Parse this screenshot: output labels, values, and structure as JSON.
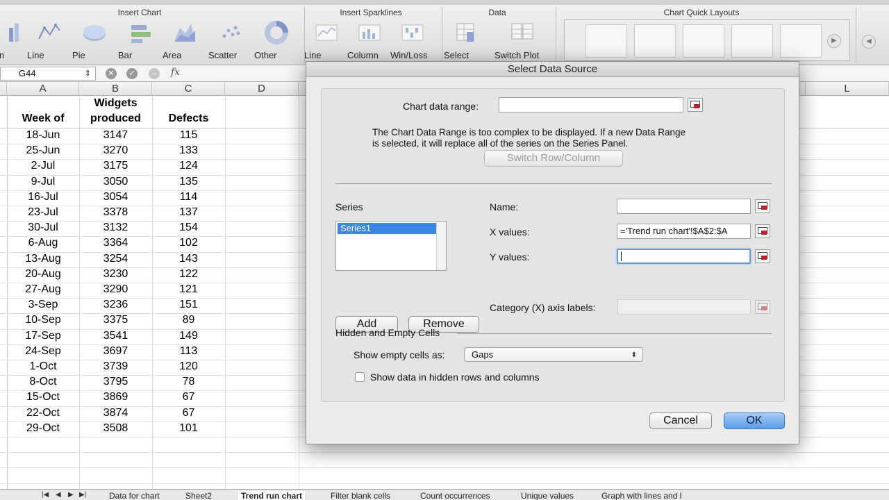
{
  "ribbon": {
    "groups": {
      "insert_chart": "Insert Chart",
      "insert_sparklines": "Insert Sparklines",
      "data": "Data",
      "chart_quick_layouts": "Chart Quick Layouts"
    },
    "chart_buttons": [
      "lumn",
      "Line",
      "Pie",
      "Bar",
      "Area",
      "Scatter",
      "Other"
    ],
    "sparkline_buttons": [
      "Line",
      "Column",
      "Win/Loss"
    ],
    "data_buttons": [
      "Select",
      "Switch Plot"
    ]
  },
  "formula_bar": {
    "name_box": "G44",
    "fx": "fx"
  },
  "sheet": {
    "columns": [
      "A",
      "B",
      "C",
      "D",
      "L"
    ],
    "headers": {
      "a": "Week of",
      "b1": "Widgets",
      "b2": "produced",
      "c": "Defects"
    },
    "rows": [
      [
        "18-Jun",
        "3147",
        "115"
      ],
      [
        "25-Jun",
        "3270",
        "133"
      ],
      [
        "2-Jul",
        "3175",
        "124"
      ],
      [
        "9-Jul",
        "3050",
        "135"
      ],
      [
        "16-Jul",
        "3054",
        "114"
      ],
      [
        "23-Jul",
        "3378",
        "137"
      ],
      [
        "30-Jul",
        "3132",
        "154"
      ],
      [
        "6-Aug",
        "3364",
        "102"
      ],
      [
        "13-Aug",
        "3254",
        "143"
      ],
      [
        "20-Aug",
        "3230",
        "122"
      ],
      [
        "27-Aug",
        "3290",
        "121"
      ],
      [
        "3-Sep",
        "3236",
        "151"
      ],
      [
        "10-Sep",
        "3375",
        "89"
      ],
      [
        "17-Sep",
        "3541",
        "149"
      ],
      [
        "24-Sep",
        "3697",
        "113"
      ],
      [
        "1-Oct",
        "3739",
        "120"
      ],
      [
        "8-Oct",
        "3795",
        "78"
      ],
      [
        "15-Oct",
        "3869",
        "67"
      ],
      [
        "22-Oct",
        "3874",
        "67"
      ],
      [
        "29-Oct",
        "3508",
        "101"
      ]
    ]
  },
  "sheet_tabs": [
    "Data for chart",
    "Sheet2",
    "Trend run chart",
    "Filter blank cells",
    "Count occurrences",
    "Unique values",
    "Graph with lines and l"
  ],
  "dialog": {
    "title": "Select Data Source",
    "chart_data_range_label": "Chart data range:",
    "chart_data_range_value": "",
    "info_line1": "The Chart Data Range is too complex to be displayed. If a new Data Range",
    "info_line2": "is selected, it will replace all of the series on the Series Panel.",
    "switch_button": "Switch Row/Column",
    "series_label": "Series",
    "series_items": [
      "Series1"
    ],
    "name_label": "Name:",
    "name_value": "",
    "x_values_label": "X values:",
    "x_values_value": "='Trend run chart'!$A$2:$A",
    "y_values_label": "Y values:",
    "y_values_value": "",
    "add_button": "Add",
    "remove_button": "Remove",
    "category_label": "Category (X) axis labels:",
    "category_value": "",
    "hidden_empty_label": "Hidden and Empty Cells",
    "show_empty_label": "Show empty cells as:",
    "show_empty_value": "Gaps",
    "show_hidden_label": "Show data in hidden rows and columns",
    "cancel_button": "Cancel",
    "ok_button": "OK"
  },
  "colors": {
    "ok_button": "#5a9ce8",
    "selection": "#3b86e0",
    "picker_accent": "#c0202a"
  }
}
